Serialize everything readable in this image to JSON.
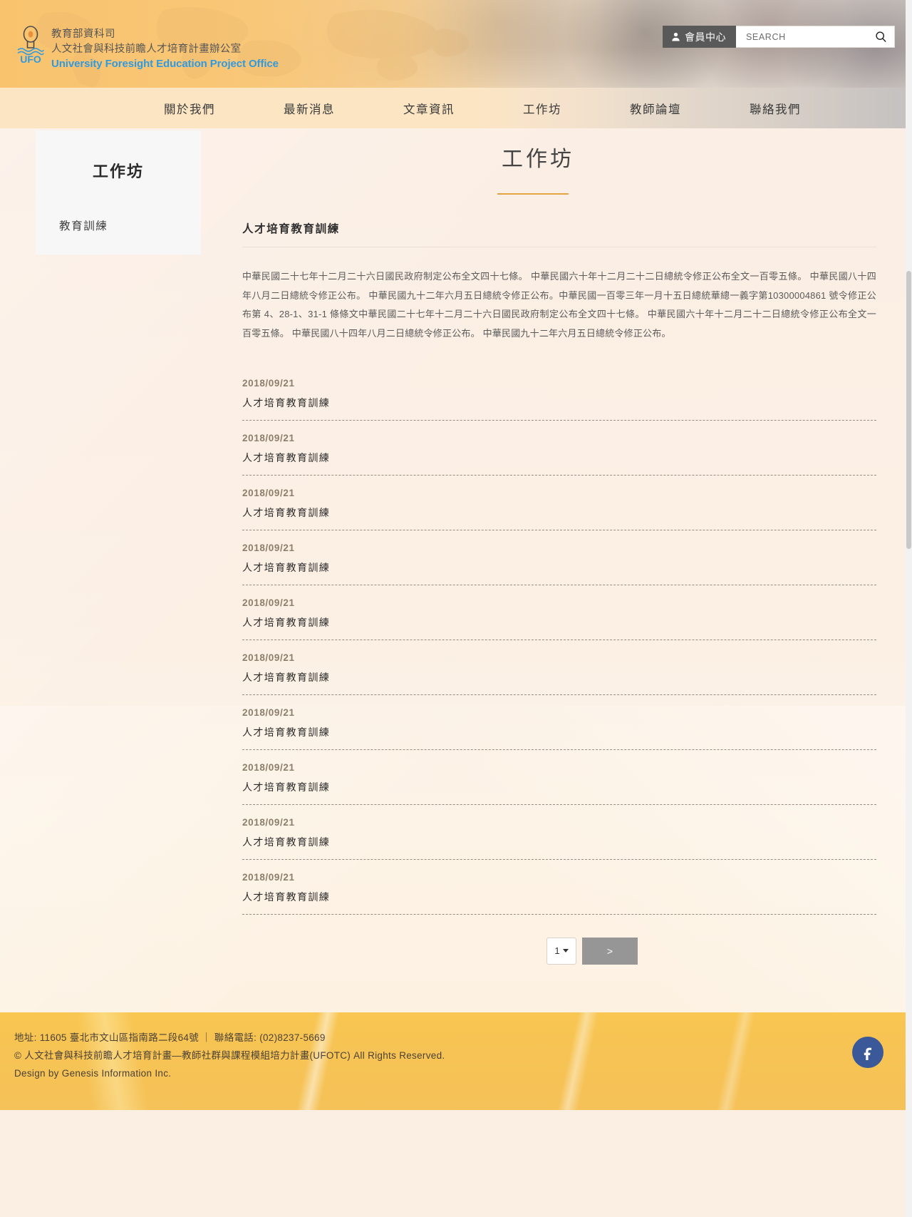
{
  "header": {
    "logo": {
      "line1": "教育部資科司",
      "line2": "人文社會與科技前瞻人才培育計畫辦公室",
      "line3": "University Foresight Education Project Office",
      "badge": "UFO",
      "brand_color": "#2f9ae0"
    },
    "member_button": "會員中心",
    "search": {
      "placeholder": "SEARCH",
      "value": ""
    }
  },
  "nav": {
    "items": [
      {
        "label": "關於我們"
      },
      {
        "label": "最新消息"
      },
      {
        "label": "文章資訊"
      },
      {
        "label": "工作坊"
      },
      {
        "label": "教師論壇"
      },
      {
        "label": "聯絡我們"
      }
    ]
  },
  "sidebar": {
    "title": "工作坊",
    "items": [
      {
        "label": "教育訓練"
      }
    ]
  },
  "main": {
    "title": "工作坊",
    "section_heading": "人才培育教育訓練",
    "accent_color": "#e3a440",
    "intro": "中華民國二十七年十二月二十六日國民政府制定公布全文四十七條。 中華民國六十年十二月二十二日總統令修正公布全文一百零五條。 中華民國八十四年八月二日總統令修正公布。 中華民國九十二年六月五日總統令修正公布。中華民國一百零三年一月十五日總統華總一義字第10300004861 號令修正公布第 4、28-1、31-1 條條文中華民國二十七年十二月二十六日國民政府制定公布全文四十七條。 中華民國六十年十二月二十二日總統令修正公布全文一百零五條。 中華民國八十四年八月二日總統令修正公布。 中華民國九十二年六月五日總統令修正公布。",
    "list": [
      {
        "date": "2018/09/21",
        "title": "人才培育教育訓練"
      },
      {
        "date": "2018/09/21",
        "title": "人才培育教育訓練"
      },
      {
        "date": "2018/09/21",
        "title": "人才培育教育訓練"
      },
      {
        "date": "2018/09/21",
        "title": "人才培育教育訓練"
      },
      {
        "date": "2018/09/21",
        "title": "人才培育教育訓練"
      },
      {
        "date": "2018/09/21",
        "title": "人才培育教育訓練"
      },
      {
        "date": "2018/09/21",
        "title": "人才培育教育訓練"
      },
      {
        "date": "2018/09/21",
        "title": "人才培育教育訓練"
      },
      {
        "date": "2018/09/21",
        "title": "人才培育教育訓練"
      },
      {
        "date": "2018/09/21",
        "title": "人才培育教育訓練"
      }
    ],
    "pager": {
      "current_page": "1",
      "next_label": ">"
    }
  },
  "footer": {
    "line1": "地址: 11605 臺北市文山區指南路二段64號 ｜ 聯絡電話: (02)8237-5669",
    "line2": "© 人文社會與科技前瞻人才培育計畫—教師社群與課程模組培力計畫(UFOTC) All Rights Reserved.",
    "line3": "Design by Genesis Information Inc.",
    "social": "facebook-icon"
  }
}
